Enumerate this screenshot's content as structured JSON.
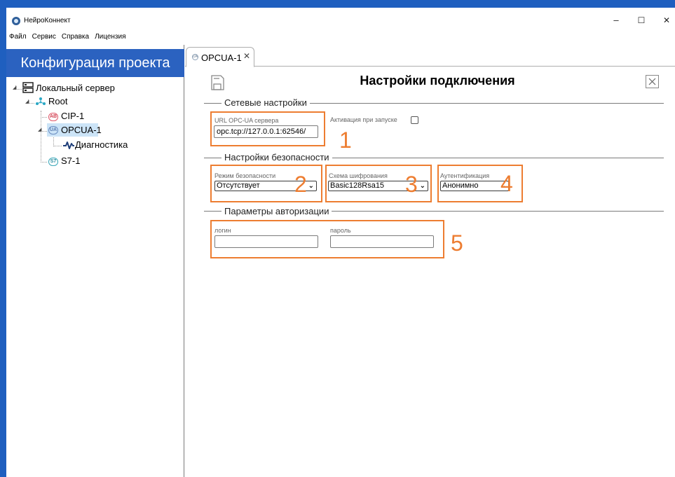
{
  "window": {
    "title": "НейроКоннект",
    "controls": {
      "minimize": "–",
      "maximize": "☐",
      "close": "✕"
    }
  },
  "menu": [
    "Файл",
    "Сервис",
    "Справка",
    "Лицензия"
  ],
  "left_panel": {
    "header": "Конфигурация проекта",
    "tree": {
      "server": "Локальный сервер",
      "root": "Root",
      "cip": {
        "badge": "AB",
        "label": "CIP-1"
      },
      "opcua": {
        "badge": "UA",
        "label": "OPCUA-1"
      },
      "diagnostics": "Диагностика",
      "s7": {
        "badge": "S7",
        "label": "S7-1"
      }
    }
  },
  "tab": {
    "badge": "UA",
    "label": "OPCUA-1",
    "close": "✕"
  },
  "page": {
    "title": "Настройки подключения",
    "network": {
      "section_title": "Сетевые настройки",
      "url_label": "URL OPC-UA сервера",
      "url_value": "opc.tcp://127.0.0.1:62546/",
      "activation_label": "Активация при запуске",
      "activation_checked": false
    },
    "security": {
      "section_title": "Настройки безопасности",
      "mode_label": "Режим безопасности",
      "mode_value": "Отсутствует",
      "scheme_label": "Схема шифрования",
      "scheme_value": "Basic128Rsa15",
      "auth_label": "Аутентификация",
      "auth_value": "Анонимно"
    },
    "authorization": {
      "section_title": "Параметры авторизации",
      "login_label": "логин",
      "login_value": "",
      "password_label": "пароль",
      "password_value": ""
    }
  },
  "annotations": [
    "1",
    "2",
    "3",
    "4",
    "5"
  ],
  "colors": {
    "accent": "#1f5fbf",
    "header": "#2b62c0",
    "highlight": "#ed7d31",
    "selection": "#cce4f7"
  }
}
